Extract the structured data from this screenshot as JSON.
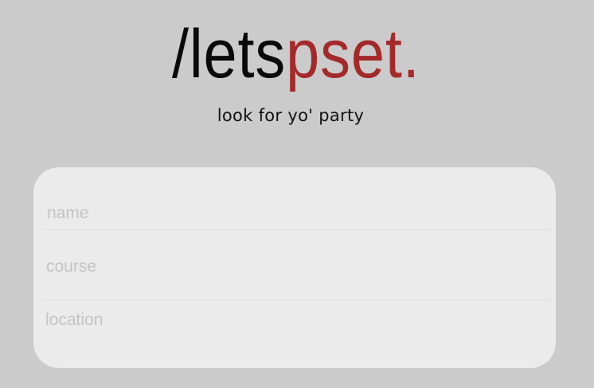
{
  "brand": {
    "prefix": "/lets",
    "suffix": "pset.",
    "accent_color": "#a42a2a"
  },
  "tagline": "look for yo' party",
  "form": {
    "fields": [
      {
        "placeholder": "name",
        "value": ""
      },
      {
        "placeholder": "course",
        "value": ""
      },
      {
        "placeholder": "location",
        "value": ""
      }
    ]
  }
}
